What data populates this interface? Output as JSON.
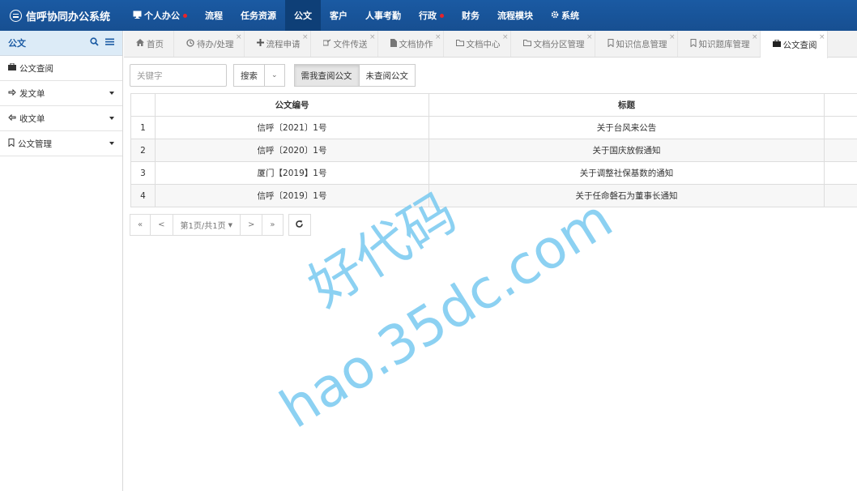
{
  "app": {
    "title": "信呼协同办公系统"
  },
  "nav": {
    "items": [
      {
        "label": "个人办公",
        "icon": "monitor-icon",
        "dot": true,
        "active": false
      },
      {
        "label": "流程",
        "active": false
      },
      {
        "label": "任务资源",
        "active": false
      },
      {
        "label": "公文",
        "active": true
      },
      {
        "label": "客户",
        "active": false
      },
      {
        "label": "人事考勤",
        "active": false
      },
      {
        "label": "行政",
        "dot": true,
        "active": false
      },
      {
        "label": "财务",
        "active": false
      },
      {
        "label": "流程模块",
        "active": false
      },
      {
        "label": "系统",
        "icon": "gear-icon",
        "active": false
      }
    ]
  },
  "sidebar": {
    "title": "公文",
    "items": [
      {
        "label": "公文查阅",
        "icon": "briefcase-icon",
        "caret": false
      },
      {
        "label": "发文单",
        "icon": "hand-right-icon",
        "caret": true
      },
      {
        "label": "收文单",
        "icon": "hand-left-icon",
        "caret": true
      },
      {
        "label": "公文管理",
        "icon": "bookmark-icon",
        "caret": true
      }
    ]
  },
  "tabs": [
    {
      "label": "首页",
      "icon": "home-icon",
      "active": false
    },
    {
      "label": "待办/处理",
      "icon": "clock-icon",
      "active": false
    },
    {
      "label": "流程申请",
      "icon": "plus-icon",
      "active": false
    },
    {
      "label": "文件传送",
      "icon": "share-icon",
      "active": false
    },
    {
      "label": "文档协作",
      "icon": "file-icon",
      "active": false
    },
    {
      "label": "文档中心",
      "icon": "folder-icon",
      "active": false
    },
    {
      "label": "文档分区管理",
      "icon": "folder-icon",
      "active": false
    },
    {
      "label": "知识信息管理",
      "icon": "bookmark-icon",
      "active": false
    },
    {
      "label": "知识题库管理",
      "icon": "bookmark-icon",
      "active": false
    },
    {
      "label": "公文查阅",
      "icon": "briefcase-icon",
      "active": true
    }
  ],
  "toolbar": {
    "search_placeholder": "关键字",
    "search_button": "搜索",
    "seg_need": "需我查阅公文",
    "seg_unread": "未查阅公文"
  },
  "table": {
    "headers": {
      "code": "公文编号",
      "title": "标题"
    },
    "rows": [
      {
        "idx": "1",
        "code": "信呼〔2021〕1号",
        "title": "关于台风来公告"
      },
      {
        "idx": "2",
        "code": "信呼〔2020〕1号",
        "title": "关于国庆放假通知"
      },
      {
        "idx": "3",
        "code": "厦门【2019】1号",
        "title": "关于调整社保基数的通知"
      },
      {
        "idx": "4",
        "code": "信呼〔2019〕1号",
        "title": "关于任命磐石为董事长通知"
      }
    ]
  },
  "pager": {
    "first": "«",
    "prev": "<",
    "page_info": "第1页/共1页",
    "next": ">",
    "last": "»"
  },
  "watermark": {
    "line1": "好代码",
    "line2": "hao.35dc.com"
  },
  "colors": {
    "topbar": "#1a5aa3",
    "accent": "#0e3f77",
    "dot": "#e8232a",
    "watermark": "#6fc6ef"
  }
}
